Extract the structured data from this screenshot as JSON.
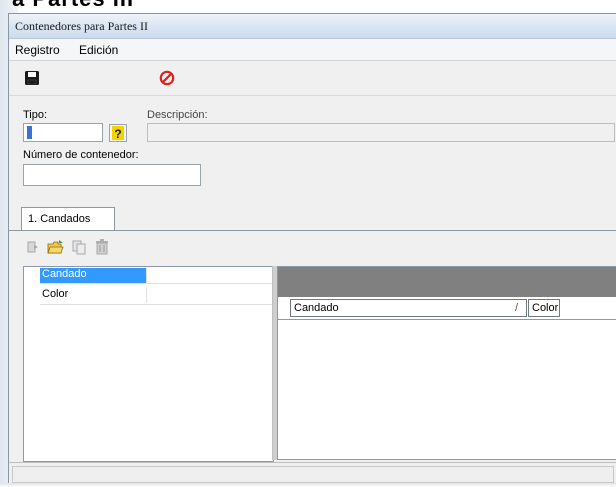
{
  "background": {
    "partial_heading": "a Partes III"
  },
  "window": {
    "title": "Contenedores para Partes II"
  },
  "menu": {
    "items": [
      "Registro",
      "Edición"
    ]
  },
  "toolbar": {
    "save_icon": "floppy-disk-icon",
    "cancel_icon": "no-entry-icon"
  },
  "form": {
    "tipo_label": "Tipo:",
    "tipo_value": "",
    "lookup_glyph": "?",
    "descripcion_label": "Descripción:",
    "descripcion_value": "",
    "numero_label": "Número de contenedor:",
    "numero_value": ""
  },
  "tabs": [
    {
      "label": "1. Candados",
      "selected": true
    }
  ],
  "subtoolbar": {
    "icons": [
      "move-right-icon",
      "open-folder-icon",
      "copy-icon",
      "delete-icon"
    ]
  },
  "properties": [
    {
      "name": "Candado",
      "value": "",
      "selected": true
    },
    {
      "name": "Color",
      "value": "",
      "selected": false
    }
  ],
  "grid": {
    "columns": [
      {
        "label": "Candado",
        "sort_indicator": "/"
      },
      {
        "label": "Color",
        "sort_indicator": ""
      }
    ],
    "rows": []
  },
  "status_bar": {
    "text": ""
  },
  "colors": {
    "selection": "#3399ff",
    "cancel_red": "#e02020",
    "group_area": "#808080",
    "lookup_yellow": "#f2d200"
  }
}
